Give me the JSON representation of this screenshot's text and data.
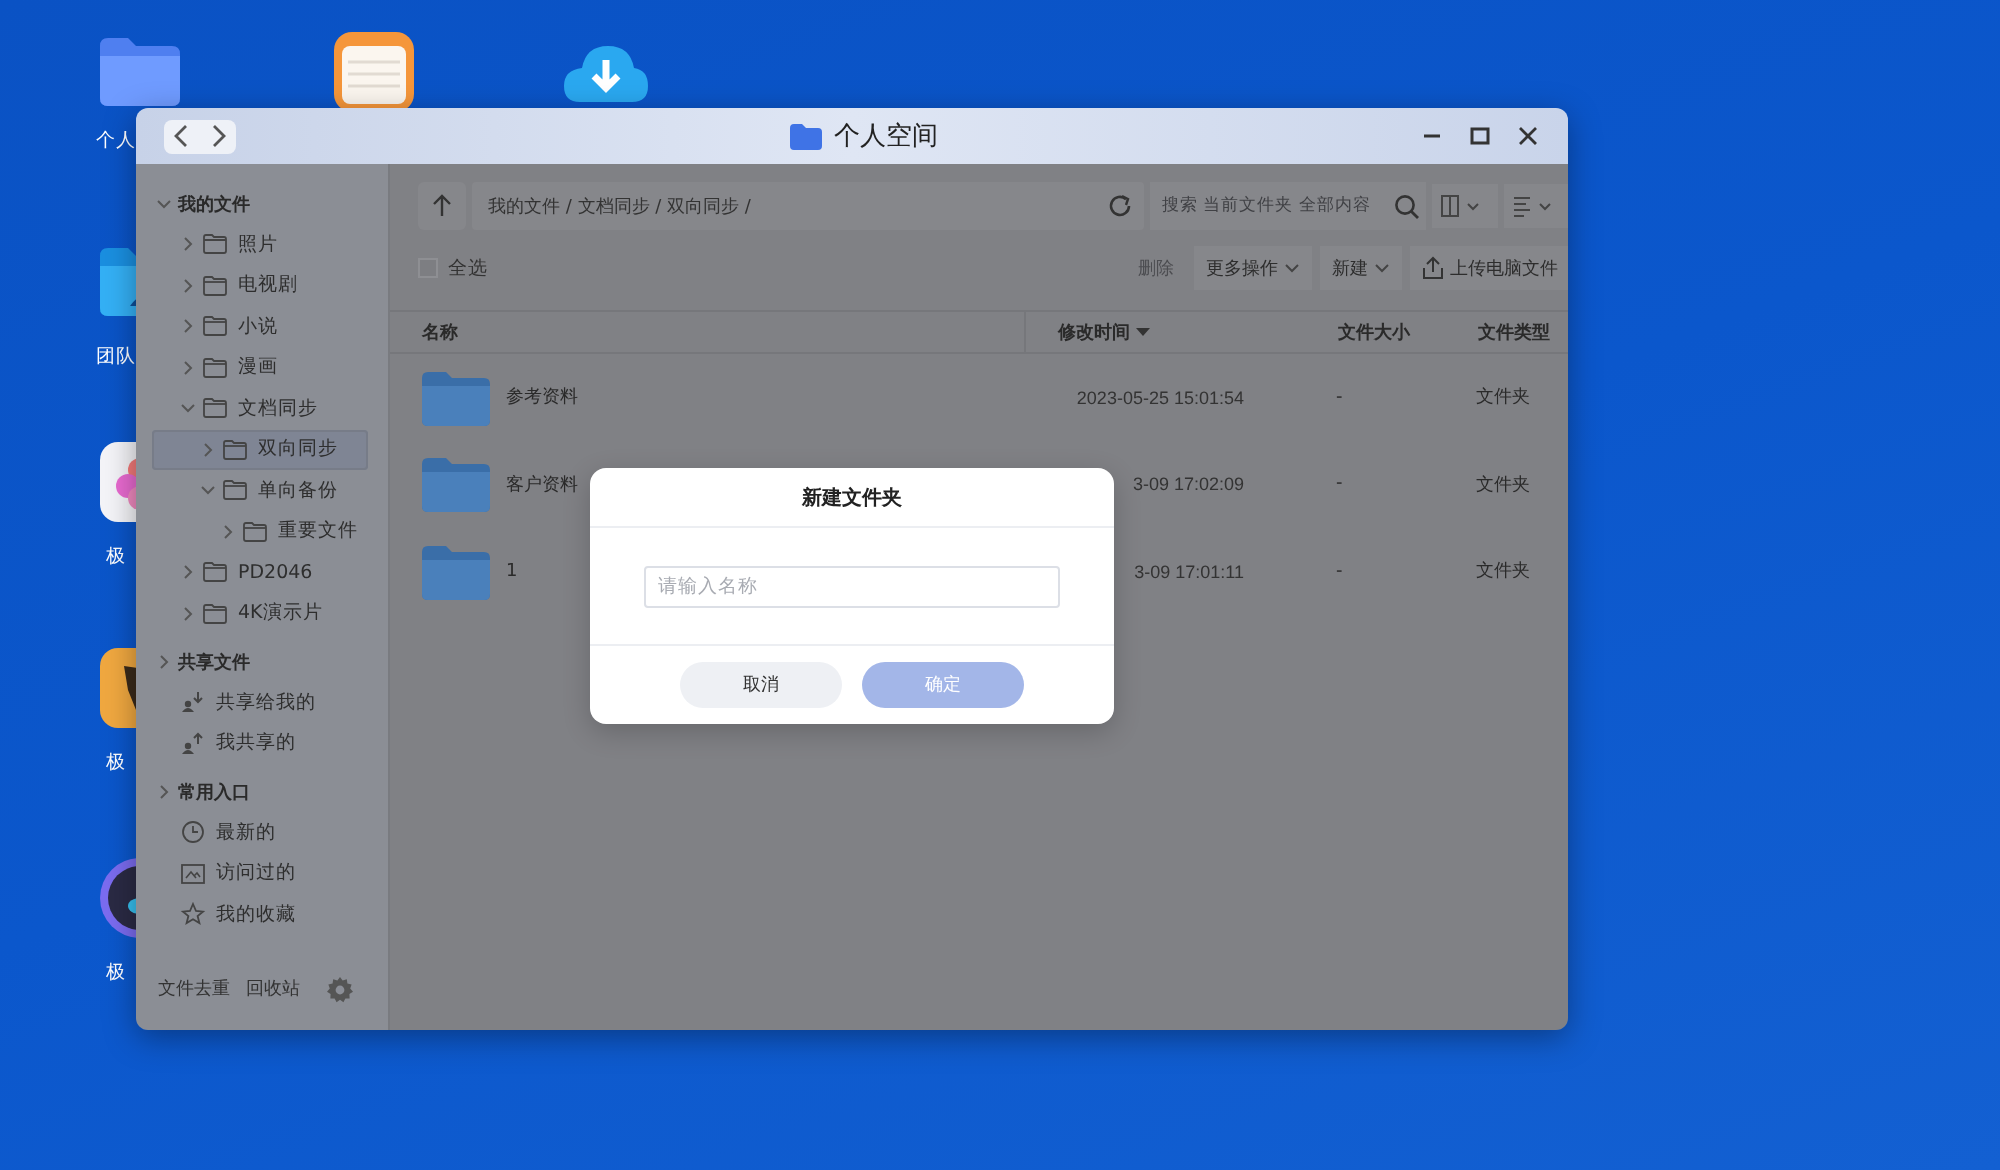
{
  "desktop": {
    "icons": [
      {
        "kind": "folder",
        "label": "个人"
      },
      {
        "kind": "notes"
      },
      {
        "kind": "cloud"
      },
      {
        "kind": "team",
        "label": "团队"
      },
      {
        "kind": "photos",
        "label": "极"
      },
      {
        "kind": "app",
        "label": "极"
      },
      {
        "kind": "player",
        "label": "极"
      }
    ]
  },
  "window": {
    "title": "个人空间",
    "sidebar": {
      "sections": [
        {
          "label": "我的文件",
          "expanded": true,
          "children": [
            {
              "kind": "folder",
              "label": "照片",
              "expanded": false,
              "selected": false
            },
            {
              "kind": "folder",
              "label": "电视剧",
              "expanded": false,
              "selected": false
            },
            {
              "kind": "folder",
              "label": "小说",
              "expanded": false,
              "selected": false
            },
            {
              "kind": "folder",
              "label": "漫画",
              "expanded": false,
              "selected": false
            },
            {
              "kind": "folder",
              "label": "文档同步",
              "expanded": true,
              "selected": false,
              "children": [
                {
                  "kind": "folder",
                  "label": "双向同步",
                  "expanded": false,
                  "selected": true
                },
                {
                  "kind": "folder",
                  "label": "单向备份",
                  "expanded": true,
                  "selected": false,
                  "children": [
                    {
                      "kind": "folder",
                      "label": "重要文件",
                      "expanded": false,
                      "selected": false
                    }
                  ]
                }
              ]
            },
            {
              "kind": "folder",
              "label": "PD2046",
              "expanded": false,
              "selected": false
            },
            {
              "kind": "folder",
              "label": "4K演示片",
              "expanded": false,
              "selected": false
            }
          ]
        },
        {
          "label": "共享文件",
          "expanded": false,
          "children": [
            {
              "kind": "shared-in",
              "label": "共享给我的",
              "selected": false
            },
            {
              "kind": "shared-out",
              "label": "我共享的",
              "selected": false
            }
          ]
        },
        {
          "label": "常用入口",
          "expanded": false,
          "children": [
            {
              "kind": "recent",
              "label": "最新的",
              "selected": false
            },
            {
              "kind": "visited",
              "label": "访问过的",
              "selected": false
            },
            {
              "kind": "favorite",
              "label": "我的收藏",
              "selected": false
            }
          ]
        }
      ],
      "footer": [
        "文件去重",
        "回收站"
      ]
    },
    "path": "我的文件 / 文档同步 / 双向同步 /",
    "search": {
      "placeholder": "搜索 当前文件夹 全部内容"
    },
    "select_all": {
      "label": "全选",
      "checked": false
    },
    "actions": [
      {
        "label": "删除",
        "disabled": true,
        "dropdown": false,
        "kind": "plain"
      },
      {
        "label": "更多操作",
        "disabled": false,
        "dropdown": true,
        "kind": "plain"
      },
      {
        "label": "新建",
        "disabled": false,
        "dropdown": true,
        "kind": "plain"
      },
      {
        "label": "上传电脑文件",
        "disabled": false,
        "dropdown": false,
        "kind": "upload"
      }
    ],
    "table": {
      "columns": [
        {
          "label": "名称",
          "sorted": false
        },
        {
          "label": "修改时间",
          "sorted": true
        },
        {
          "label": "文件大小",
          "sorted": false
        },
        {
          "label": "文件类型",
          "sorted": false
        }
      ],
      "rows": [
        {
          "name": "参考资料",
          "modified": "2023-05-25 15:01:54",
          "size": "-",
          "type": "文件夹"
        },
        {
          "name": "客户资料",
          "modified": "3-09 17:02:09",
          "size": "-",
          "type": "文件夹"
        },
        {
          "name": "1",
          "modified": "3-09 17:01:11",
          "size": "-",
          "type": "文件夹"
        }
      ]
    }
  },
  "dialog": {
    "title": "新建文件夹",
    "input": {
      "placeholder": "请输入名称"
    },
    "buttons": [
      {
        "label": "取消",
        "kind": "secondary",
        "disabled": false
      },
      {
        "label": "确定",
        "kind": "primary",
        "disabled": true
      }
    ]
  }
}
